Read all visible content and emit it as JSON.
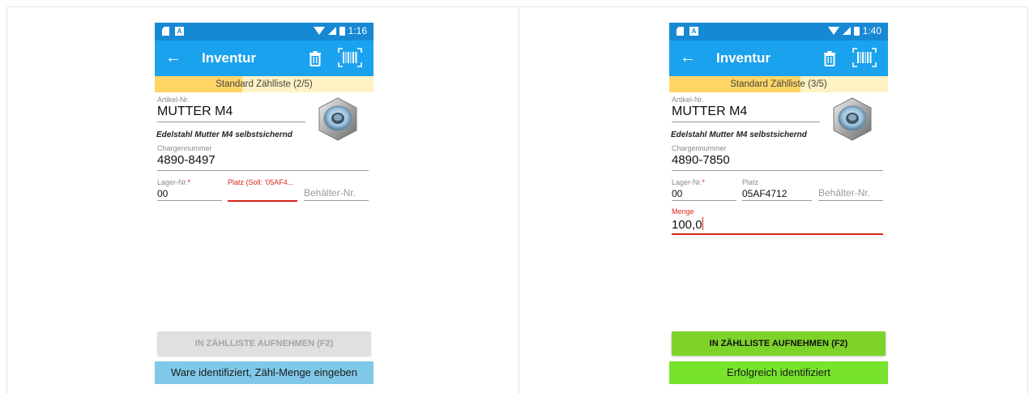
{
  "screens": [
    {
      "status": {
        "time": "1:16"
      },
      "appbar": {
        "title": "Inventur"
      },
      "progress": {
        "label": "Standard Zählliste (2/5)",
        "current": 2,
        "total": 5
      },
      "article": {
        "label": "Artikel-Nr.",
        "value": "MUTTER M4",
        "description": "Edelstahl Mutter M4 selbstsichernd"
      },
      "batch": {
        "label": "Chargennummer",
        "value": "4890-8497"
      },
      "storage": {
        "label": "Lager-Nr.",
        "required_mark": "*",
        "value": "00"
      },
      "place": {
        "label": "Platz (Soll: '05AF4...",
        "value": ""
      },
      "container": {
        "placeholder": "Behälter-Nr."
      },
      "action": {
        "label": "IN ZÄHLLISTE AUFNEHMEN (F2)",
        "enabled": false
      },
      "status_message": "Ware identifiziert, Zähl-Menge eingeben",
      "colors": {
        "status_message_bg": "#80c8e8"
      }
    },
    {
      "status": {
        "time": "1:40"
      },
      "appbar": {
        "title": "Inventur"
      },
      "progress": {
        "label": "Standard Zählliste (3/5)",
        "current": 3,
        "total": 5
      },
      "article": {
        "label": "Artikel-Nr.",
        "value": "MUTTER M4",
        "description": "Edelstahl Mutter M4 selbstsichernd"
      },
      "batch": {
        "label": "Chargennummer",
        "value": "4890-7850"
      },
      "storage": {
        "label": "Lager-Nr.",
        "required_mark": "*",
        "value": "00"
      },
      "place": {
        "label": "Platz",
        "value": "05AF4712"
      },
      "container": {
        "placeholder": "Behälter-Nr."
      },
      "quantity": {
        "label": "Menge",
        "value": "100,0"
      },
      "action": {
        "label": "IN ZÄHLLISTE AUFNEHMEN (F2)",
        "enabled": true
      },
      "status_message": "Erfolgreich identifiziert",
      "colors": {
        "status_message_bg": "#77e32d"
      }
    }
  ],
  "icons": {
    "back": "arrow-left",
    "trash": "trash-can",
    "barcode": "barcode-scan",
    "sd_card": "sd-card",
    "notification": "a-box",
    "wifi": "wifi",
    "signal": "cell-signal",
    "battery": "battery"
  },
  "colors": {
    "statusbar": "#1789d4",
    "appbar": "#1ba2ee",
    "progress_fill": "#ffd666",
    "progress_track": "#fff2c4",
    "error": "#d9261c",
    "button_enabled": "#7ed32a",
    "button_disabled": "#e0e0e0"
  }
}
